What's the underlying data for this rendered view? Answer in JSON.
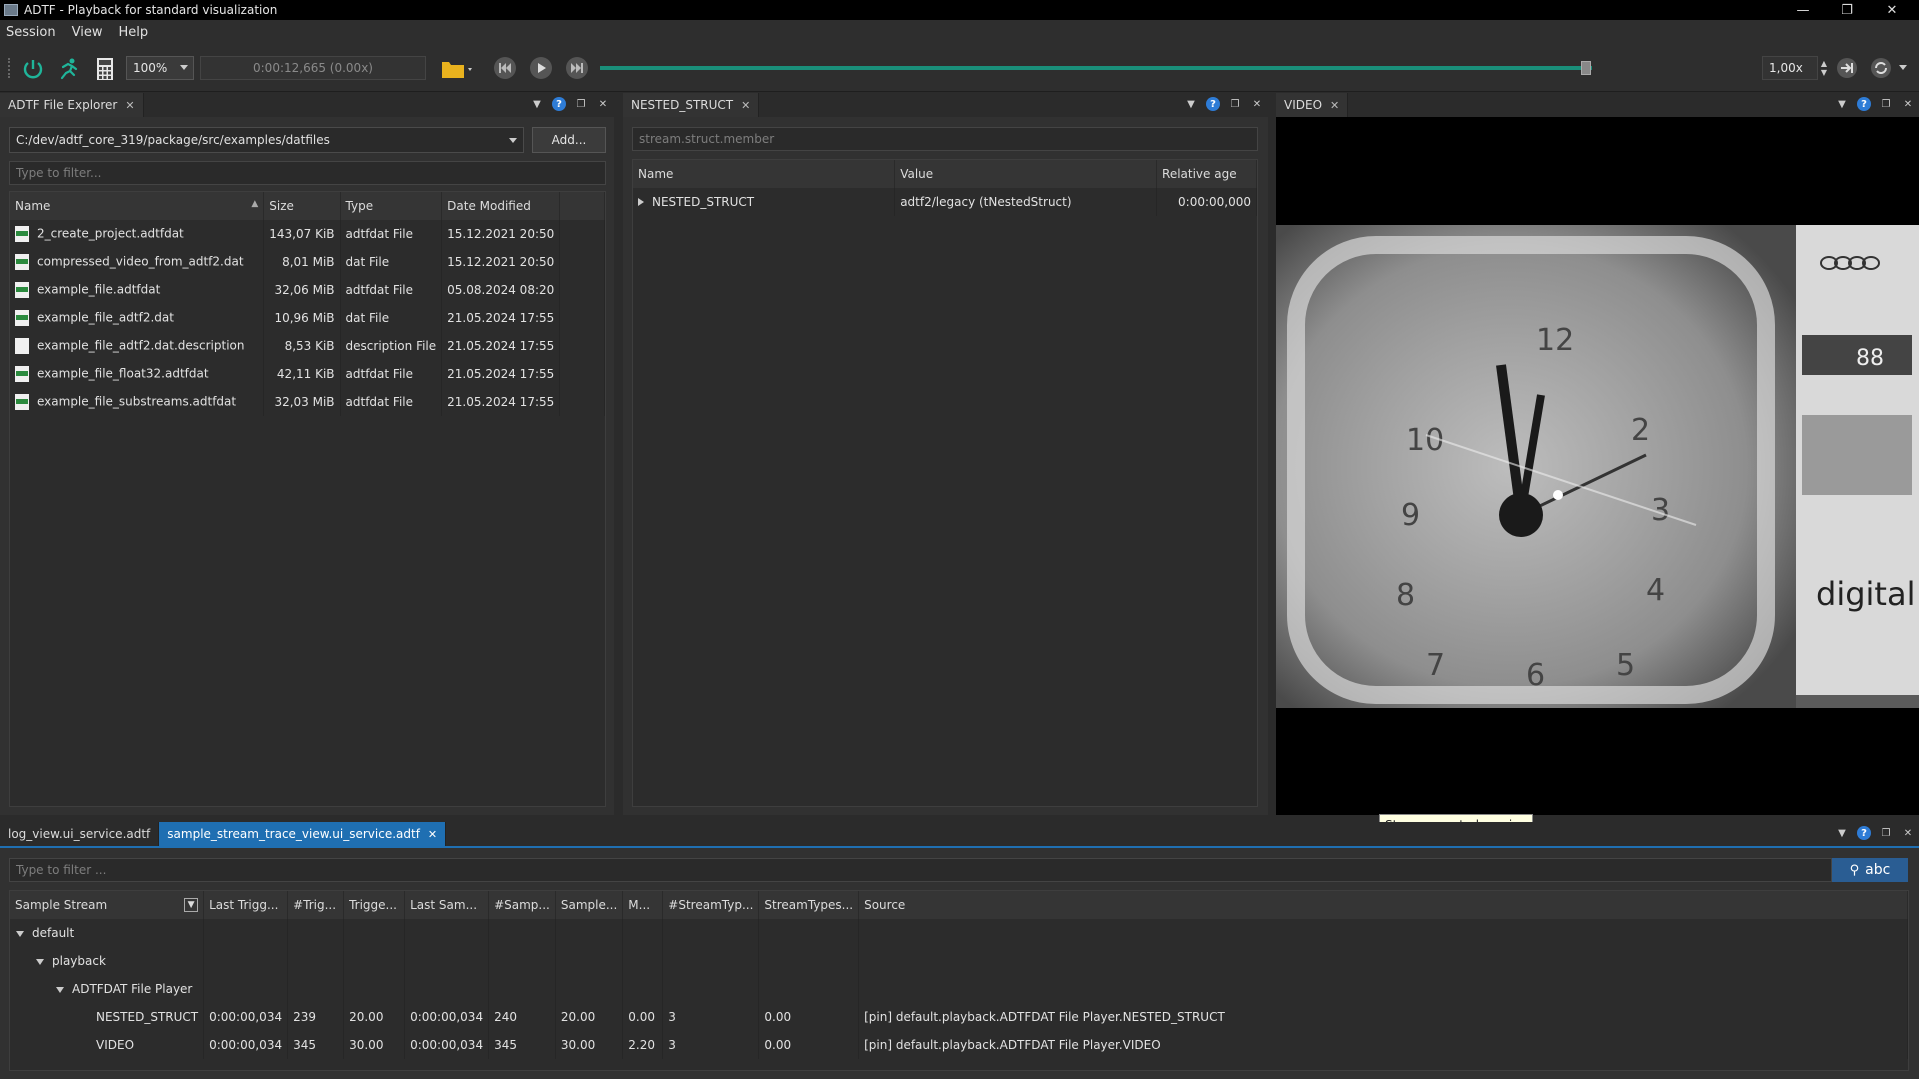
{
  "window": {
    "title": "ADTF - Playback for standard visualization"
  },
  "menubar": {
    "items": [
      "Session",
      "View",
      "Help"
    ]
  },
  "toolbar": {
    "zoom": "100%",
    "time_display": "0:00:12,665 (0.00x)",
    "speed": "1,00x",
    "icons": [
      "power-icon",
      "run-icon",
      "calculator-icon",
      "folder-icon",
      "skip-back-icon",
      "play-icon",
      "skip-forward-icon",
      "connect-icon",
      "loop-icon"
    ],
    "progress": 0.99
  },
  "file_explorer": {
    "tab": "ADTF File Explorer",
    "path": "C:/dev/adtf_core_319/package/src/examples/datfiles",
    "add_button": "Add...",
    "filter_placeholder": "Type to filter...",
    "columns": [
      "Name",
      "Size",
      "Type",
      "Date Modified"
    ],
    "rows": [
      {
        "name": "2_create_project.adtfdat",
        "size": "143,07 KiB",
        "type": "adtfdat File",
        "date": "15.12.2021 20:50",
        "icon": "dat"
      },
      {
        "name": "compressed_video_from_adtf2.dat",
        "size": "8,01 MiB",
        "type": "dat File",
        "date": "15.12.2021 20:50",
        "icon": "dat"
      },
      {
        "name": "example_file.adtfdat",
        "size": "32,06 MiB",
        "type": "adtfdat File",
        "date": "05.08.2024 08:20",
        "icon": "dat"
      },
      {
        "name": "example_file_adtf2.dat",
        "size": "10,96 MiB",
        "type": "dat File",
        "date": "21.05.2024 17:55",
        "icon": "dat"
      },
      {
        "name": "example_file_adtf2.dat.description",
        "size": "8,53 KiB",
        "type": "description File",
        "date": "21.05.2024 17:55",
        "icon": "plain"
      },
      {
        "name": "example_file_float32.adtfdat",
        "size": "42,11 KiB",
        "type": "adtfdat File",
        "date": "21.05.2024 17:55",
        "icon": "dat"
      },
      {
        "name": "example_file_substreams.adtfdat",
        "size": "32,03 MiB",
        "type": "adtfdat File",
        "date": "21.05.2024 17:55",
        "icon": "dat"
      }
    ]
  },
  "nested_struct": {
    "tab": "NESTED_STRUCT",
    "filter_placeholder": "stream.struct.member",
    "columns": [
      "Name",
      "Value",
      "Relative age"
    ],
    "rows": [
      {
        "name": "NESTED_STRUCT",
        "value": "adtf2/legacy (tNestedStruct)",
        "age": "0:00:00,000"
      }
    ]
  },
  "video": {
    "tab": "VIDEO",
    "overlay_text": "digital"
  },
  "bottom": {
    "tabs": [
      "log_view.ui_service.adtf",
      "sample_stream_trace_view.ui_service.adtf"
    ],
    "active_tab": 1,
    "filter_placeholder": "Type to filter ...",
    "search_mode": "abc",
    "columns": [
      "Sample Stream",
      "Last Trigg...",
      "#Trig...",
      "Trigge...",
      "Last Sam...",
      "#Samp...",
      "Sample...",
      "M...",
      "#StreamTyp...",
      "StreamTypes...",
      "Source"
    ],
    "tree": [
      {
        "level": 0,
        "label": "default",
        "expanded": true
      },
      {
        "level": 1,
        "label": "playback",
        "expanded": true
      },
      {
        "level": 2,
        "label": "ADTFDAT File Player",
        "expanded": true
      }
    ],
    "rows": [
      {
        "label": "NESTED_STRUCT",
        "cells": [
          "0:00:00,034",
          "239",
          "20.00",
          "0:00:00,034",
          "240",
          "20.00",
          "0.00",
          "3",
          "0.00",
          "[pin] default.playback.ADTFDAT File Player.NESTED_STRUCT"
        ]
      },
      {
        "label": "VIDEO",
        "cells": [
          "0:00:00,034",
          "345",
          "30.00",
          "0:00:00,034",
          "345",
          "30.00",
          "2.20",
          "3",
          "0.00",
          "[pin] default.playback.ADTFDAT File Player.VIDEO"
        ]
      }
    ]
  },
  "tooltip": "Stop connected session"
}
